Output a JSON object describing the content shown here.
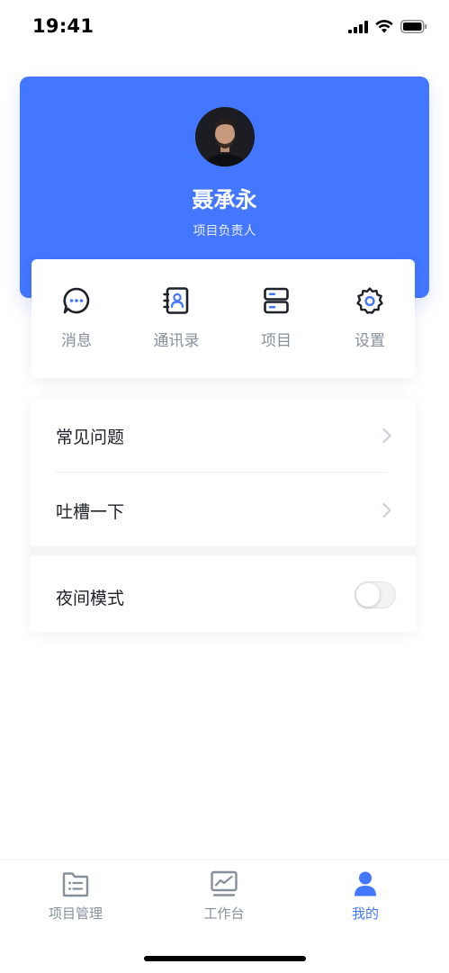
{
  "status_bar": {
    "time": "19:41"
  },
  "profile": {
    "name": "聂承永",
    "role": "项目负责人"
  },
  "quick_actions": [
    {
      "label": "消息",
      "icon": "message-icon"
    },
    {
      "label": "通讯录",
      "icon": "contacts-icon"
    },
    {
      "label": "项目",
      "icon": "project-icon"
    },
    {
      "label": "设置",
      "icon": "settings-icon"
    }
  ],
  "menu": {
    "faq": "常见问题",
    "feedback": "吐槽一下",
    "night_mode": "夜间模式",
    "night_mode_on": false
  },
  "tab_bar": {
    "tabs": [
      {
        "label": "项目管理",
        "icon": "project-list-icon",
        "active": false
      },
      {
        "label": "工作台",
        "icon": "dashboard-chart-icon",
        "active": false
      },
      {
        "label": "我的",
        "icon": "user-icon",
        "active": true
      }
    ]
  },
  "colors": {
    "accent": "#4477ff",
    "muted_text": "#86909c",
    "primary_text": "#1d2129"
  }
}
